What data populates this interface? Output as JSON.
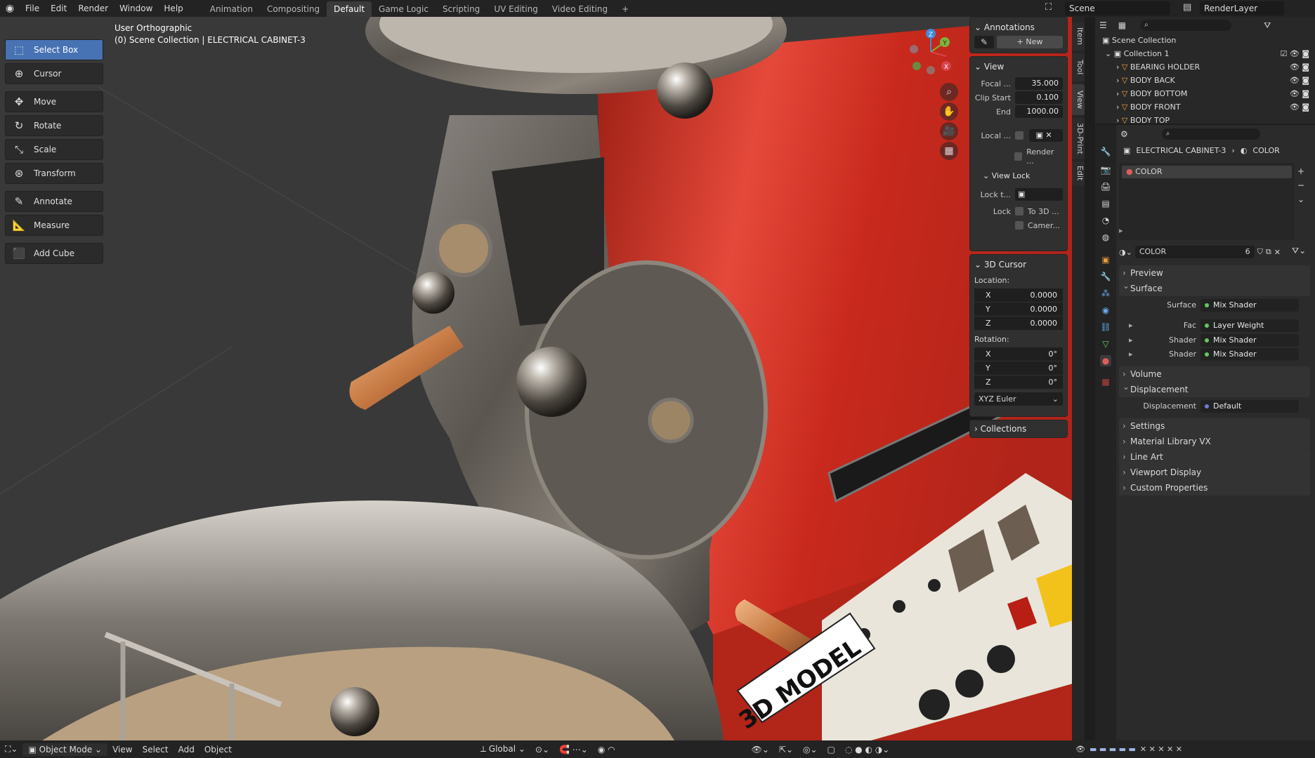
{
  "topbar": {
    "menus": [
      "File",
      "Edit",
      "Render",
      "Window",
      "Help"
    ],
    "workspaces": [
      "Animation",
      "Compositing",
      "Default",
      "Game Logic",
      "Scripting",
      "UV Editing",
      "Video Editing",
      "+"
    ],
    "active_workspace": "Default",
    "scene": "Scene",
    "render_layer": "RenderLayer"
  },
  "viewport": {
    "view_name": "User Orthographic",
    "collection_path": "(0) Scene Collection | ELECTRICAL CABINET-3",
    "tools": [
      "Select Box",
      "Cursor",
      "Move",
      "Rotate",
      "Scale",
      "Transform",
      "Annotate",
      "Measure",
      "Add Cube"
    ],
    "tag_text": "3D MODEL",
    "gizmo": {
      "z": "Z",
      "y": "Y",
      "x": "X"
    }
  },
  "npanel": {
    "annotations": {
      "title": "Annotations",
      "new_label": "New"
    },
    "view": {
      "title": "View",
      "focal_label": "Focal ...",
      "focal_value": "35.000",
      "clip_start_label": "Clip Start",
      "clip_start_value": "0.100",
      "end_label": "End",
      "end_value": "1000.00",
      "local_label": "Local ...",
      "render_label": "Render ...",
      "view_lock_title": "View Lock",
      "lock_to_label": "Lock t...",
      "lock_label": "Lock",
      "to3d_label": "To 3D ...",
      "camera_label": "Camer..."
    },
    "cursor": {
      "title": "3D Cursor",
      "location_label": "Location:",
      "loc": [
        {
          "axis": "X",
          "value": "0.0000"
        },
        {
          "axis": "Y",
          "value": "0.0000"
        },
        {
          "axis": "Z",
          "value": "0.0000"
        }
      ],
      "rotation_label": "Rotation:",
      "rot": [
        {
          "axis": "X",
          "value": "0°"
        },
        {
          "axis": "Y",
          "value": "0°"
        },
        {
          "axis": "Z",
          "value": "0°"
        }
      ],
      "rotation_mode": "XYZ Euler"
    },
    "collections_title": "Collections",
    "tabs": [
      "Item",
      "Tool",
      "View",
      "3D-Print",
      "Edit"
    ]
  },
  "outliner": {
    "root": "Scene Collection",
    "collection": "Collection 1",
    "items": [
      "BEARING HOLDER",
      "BODY BACK",
      "BODY BOTTOM",
      "BODY FRONT",
      "BODY TOP"
    ]
  },
  "properties": {
    "breadcrumb_object": "ELECTRICAL CABINET-3",
    "breadcrumb_material": "COLOR",
    "slot_name": "COLOR",
    "material_name": "COLOR",
    "users": "6",
    "panels": {
      "preview": "Preview",
      "surface": "Surface",
      "volume": "Volume",
      "displacement": "Displacement",
      "settings": "Settings",
      "material_library": "Material Library VX",
      "line_art": "Line Art",
      "viewport_display": "Viewport Display",
      "custom_properties": "Custom Properties"
    },
    "surface_rows": [
      {
        "label": "Surface",
        "value": "Mix Shader"
      },
      {
        "label": "Fac",
        "value": "Layer Weight"
      },
      {
        "label": "Shader",
        "value": "Mix Shader"
      },
      {
        "label": "Shader",
        "value": "Mix Shader"
      }
    ],
    "displacement_row": {
      "label": "Displacement",
      "value": "Default"
    }
  },
  "bottombar": {
    "mode": "Object Mode",
    "menus": [
      "View",
      "Select",
      "Add",
      "Object"
    ],
    "orientation": "Global"
  }
}
